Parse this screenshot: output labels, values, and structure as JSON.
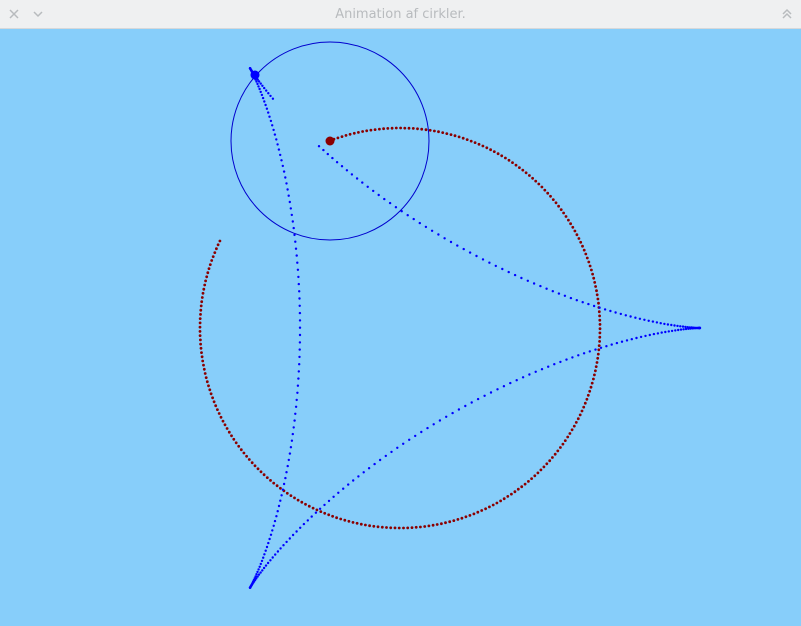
{
  "window": {
    "title": "Animation af cirkler.",
    "buttons": {
      "close": "close-icon",
      "minimize": "chevron-down-icon",
      "shade": "double-chevron-up-icon"
    }
  },
  "canvas": {
    "background": "#87cefa",
    "colors": {
      "large_circle_trace": "#8b0000",
      "small_circle_outline": "#0000cd",
      "hypocycloid_trace": "#0000ff"
    }
  }
}
